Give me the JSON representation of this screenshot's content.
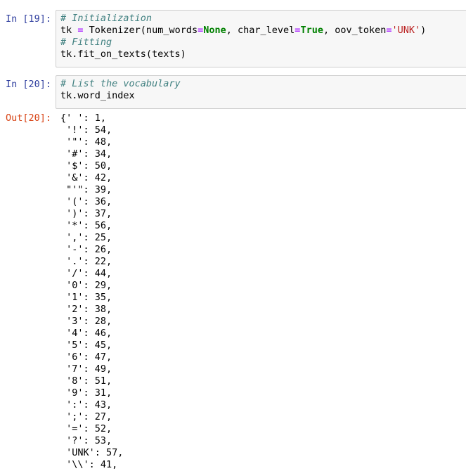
{
  "cells": [
    {
      "prompt": "In [19]:",
      "lines": [
        {
          "parts": [
            {
              "t": "# Initialization",
              "c": "comment"
            }
          ]
        },
        {
          "parts": [
            {
              "t": "tk ",
              "c": ""
            },
            {
              "t": "=",
              "c": "op"
            },
            {
              "t": " Tokenizer(num_words",
              "c": ""
            },
            {
              "t": "=",
              "c": "op"
            },
            {
              "t": "None",
              "c": "keyword"
            },
            {
              "t": ", char_level",
              "c": ""
            },
            {
              "t": "=",
              "c": "op"
            },
            {
              "t": "True",
              "c": "keyword"
            },
            {
              "t": ", oov_token",
              "c": ""
            },
            {
              "t": "=",
              "c": "op"
            },
            {
              "t": "'UNK'",
              "c": "string"
            },
            {
              "t": ")",
              "c": ""
            }
          ]
        },
        {
          "parts": [
            {
              "t": "# Fitting",
              "c": "comment"
            }
          ]
        },
        {
          "parts": [
            {
              "t": "tk.fit_on_texts(texts)",
              "c": ""
            }
          ]
        }
      ]
    },
    {
      "prompt": "In [20]:",
      "lines": [
        {
          "parts": [
            {
              "t": "# List the vocabulary",
              "c": "comment"
            }
          ]
        },
        {
          "parts": [
            {
              "t": "tk.word_index",
              "c": ""
            }
          ]
        }
      ]
    }
  ],
  "output": {
    "prompt": "Out[20]:",
    "lines": [
      "{' ': 1,",
      " '!': 54,",
      " '\"': 48,",
      " '#': 34,",
      " '$': 50,",
      " '&': 42,",
      " \"'\": 39,",
      " '(': 36,",
      " ')': 37,",
      " '*': 56,",
      " ',': 25,",
      " '-': 26,",
      " '.': 22,",
      " '/': 44,",
      " '0': 29,",
      " '1': 35,",
      " '2': 38,",
      " '3': 28,",
      " '4': 46,",
      " '5': 45,",
      " '6': 47,",
      " '7': 49,",
      " '8': 51,",
      " '9': 31,",
      " ':': 43,",
      " ';': 27,",
      " '=': 52,",
      " '?': 53,",
      " 'UNK': 57,",
      " '\\\\': 41,"
    ]
  }
}
